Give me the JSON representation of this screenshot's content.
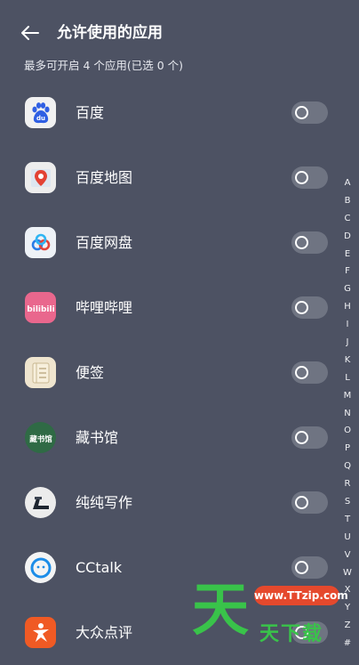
{
  "header": {
    "title": "允许使用的应用",
    "subtitle": "最多可开启 4 个应用(已选 0 个)"
  },
  "apps": [
    {
      "label": "百度",
      "icon": "baidu-icon",
      "enabled": false
    },
    {
      "label": "百度地图",
      "icon": "baidu-map-icon",
      "enabled": false
    },
    {
      "label": "百度网盘",
      "icon": "baidu-netdisk-icon",
      "enabled": false
    },
    {
      "label": "哔哩哔哩",
      "icon": "bilibili-icon",
      "enabled": false
    },
    {
      "label": "便签",
      "icon": "notes-icon",
      "enabled": false
    },
    {
      "label": "藏书馆",
      "icon": "library-icon",
      "enabled": false
    },
    {
      "label": "纯纯写作",
      "icon": "writing-icon",
      "enabled": false
    },
    {
      "label": "CCtalk",
      "icon": "cctalk-icon",
      "enabled": false
    },
    {
      "label": "大众点评",
      "icon": "dianping-icon",
      "enabled": false
    }
  ],
  "icon_texts": {
    "baidu": "du",
    "bilibili": "bilibili",
    "library": "藏书馆"
  },
  "alphabet_index": [
    "A",
    "B",
    "C",
    "D",
    "E",
    "F",
    "G",
    "H",
    "I",
    "J",
    "K",
    "L",
    "M",
    "N",
    "O",
    "P",
    "Q",
    "R",
    "S",
    "T",
    "U",
    "V",
    "W",
    "X",
    "Y",
    "Z",
    "#"
  ],
  "watermark": {
    "big": "天",
    "site": "www.TTzip.com",
    "brand": "天下载"
  },
  "colors": {
    "background": "#4d5263",
    "toggle_off": "#6f7482",
    "watermark_green": "#39c34a",
    "watermark_red": "#e5492d"
  }
}
